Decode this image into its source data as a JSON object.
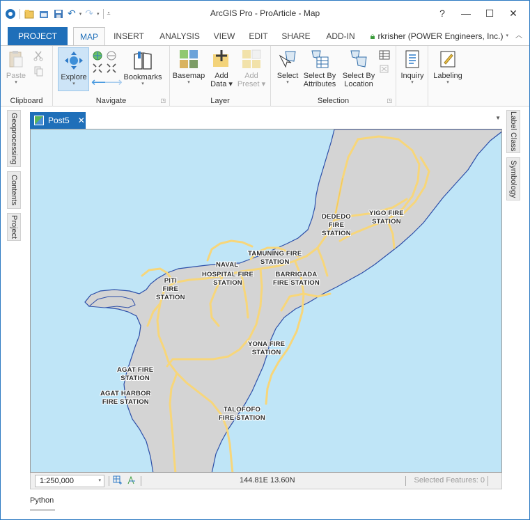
{
  "window": {
    "title": "ArcGIS Pro - ProArticle - Map"
  },
  "window_controls": {
    "help": "?",
    "minimize": "—",
    "maximize": "☐",
    "close": "✕"
  },
  "ribbon_tabs": [
    "PROJECT",
    "MAP",
    "INSERT",
    "ANALYSIS",
    "VIEW",
    "EDIT",
    "SHARE",
    "ADD-IN"
  ],
  "active_tab": "MAP",
  "user": {
    "name": "rkrisher (POWER Engineers, Inc.)"
  },
  "groups": {
    "clipboard": {
      "label": "Clipboard",
      "paste": "Paste"
    },
    "navigate": {
      "label": "Navigate",
      "explore": "Explore",
      "bookmarks": "Bookmarks"
    },
    "layer": {
      "label": "Layer",
      "basemap": "Basemap",
      "add_data_1": "Add",
      "add_data_2": "Data",
      "add_preset_1": "Add",
      "add_preset_2": "Preset"
    },
    "selection": {
      "label": "Selection",
      "select": "Select",
      "select_attr_1": "Select By",
      "select_attr_2": "Attributes",
      "select_loc_1": "Select By",
      "select_loc_2": "Location"
    },
    "inquiry": {
      "label": "Inquiry"
    },
    "labeling": {
      "label": "Labeling"
    }
  },
  "left_dock": [
    "Geoprocessing",
    "Contents",
    "Project"
  ],
  "right_dock": [
    "Label Class",
    "Symbology"
  ],
  "view_tab": {
    "name": "Post5"
  },
  "map_labels": [
    {
      "l1": "DEDEDO",
      "l2": "FIRE",
      "l3": "STATION"
    },
    {
      "l1": "YIGO FIRE",
      "l2": "STATION"
    },
    {
      "l1": "TAMUNING FIRE",
      "l2": "STATION"
    },
    {
      "l1": "NAVAL"
    },
    {
      "l1": "HOSPITAL FIRE",
      "l2": "STATION"
    },
    {
      "l1": "BARRIGADA",
      "l2": "FIRE STATION"
    },
    {
      "l1": "PITI",
      "l2": "FIRE",
      "l3": "STATION"
    },
    {
      "l1": "YONA FIRE",
      "l2": "STATION"
    },
    {
      "l1": "AGAT FIRE",
      "l2": "STATION"
    },
    {
      "l1": "AGAT HARBOR",
      "l2": "FIRE STATION"
    },
    {
      "l1": "TALOFOFO",
      "l2": "FIRE STATION"
    }
  ],
  "status": {
    "scale": "1:250,000",
    "coords": "144.81E 13.60N",
    "selected": "Selected Features: 0"
  },
  "python_tab": "Python",
  "colors": {
    "accent": "#1f6fb9",
    "water": "#bfe5f7",
    "land": "#d4d4d4",
    "road": "#f7d67a"
  }
}
